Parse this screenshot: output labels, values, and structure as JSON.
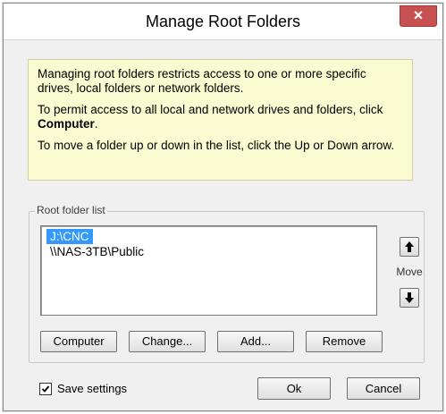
{
  "window": {
    "title": "Manage Root Folders",
    "close_label": "×"
  },
  "info": {
    "line1": "Managing root folders restricts access to one or more specific drives, local folders or network folders.",
    "line2_pre": "To permit access to all local and network drives and folders, click ",
    "line2_bold": "Computer",
    "line2_post": ".",
    "line3": "To move a folder up or down in the list, click the Up or Down arrow."
  },
  "root_list": {
    "legend": "Root folder list",
    "items": [
      "J:\\CNC",
      "\\\\NAS-3TB\\Public"
    ],
    "selected_index": 0,
    "move_label": "Move"
  },
  "buttons": {
    "computer": "Computer",
    "change": "Change...",
    "add": "Add...",
    "remove": "Remove",
    "ok": "Ok",
    "cancel": "Cancel"
  },
  "save_settings": {
    "label": "Save settings",
    "checked": true
  },
  "icons": {
    "close": "close-icon",
    "up": "arrow-up-icon",
    "down": "arrow-down-icon",
    "check": "checkmark-icon"
  },
  "colors": {
    "info_background": "#fbfbd2",
    "selection": "#3399ff",
    "close_button": "#c75050"
  }
}
